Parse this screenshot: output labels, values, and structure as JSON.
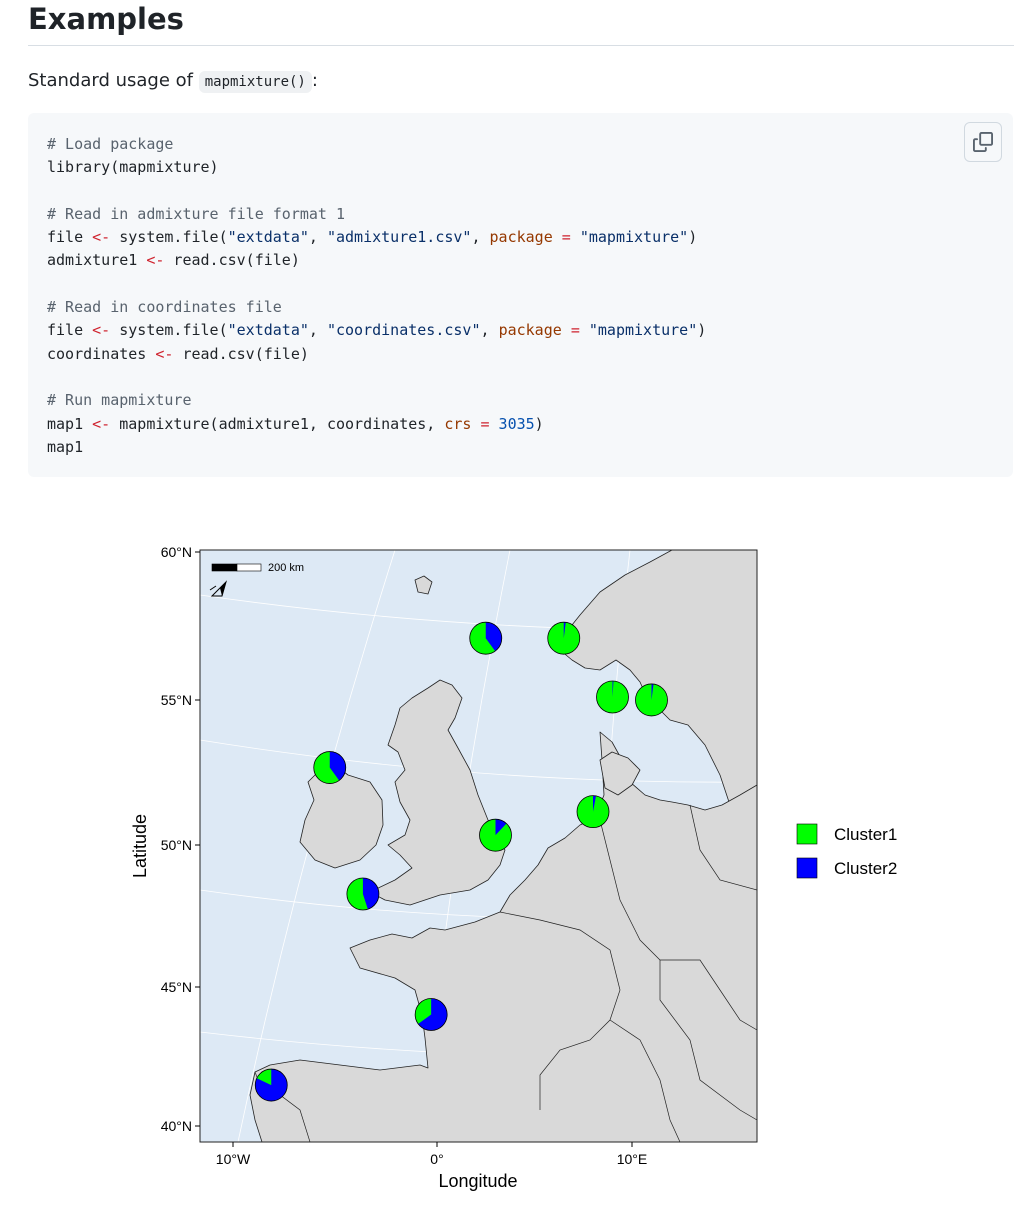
{
  "section": {
    "heading": "Examples",
    "intro_prefix": "Standard usage of ",
    "intro_code": "mapmixture()",
    "intro_suffix": ":"
  },
  "code_block": {
    "lines": [
      [
        {
          "t": "# Load package",
          "c": "comment"
        }
      ],
      [
        {
          "t": "library(mapmixture)",
          "c": "plain"
        }
      ],
      [],
      [
        {
          "t": "# Read in admixture file format 1",
          "c": "comment"
        }
      ],
      [
        {
          "t": "file ",
          "c": "plain"
        },
        {
          "t": "<-",
          "c": "op"
        },
        {
          "t": " system.file(",
          "c": "plain"
        },
        {
          "t": "\"extdata\"",
          "c": "string"
        },
        {
          "t": ", ",
          "c": "plain"
        },
        {
          "t": "\"admixture1.csv\"",
          "c": "string"
        },
        {
          "t": ", ",
          "c": "plain"
        },
        {
          "t": "package",
          "c": "arg"
        },
        {
          "t": " ",
          "c": "plain"
        },
        {
          "t": "=",
          "c": "op"
        },
        {
          "t": " ",
          "c": "plain"
        },
        {
          "t": "\"mapmixture\"",
          "c": "string"
        },
        {
          "t": ")",
          "c": "plain"
        }
      ],
      [
        {
          "t": "admixture1 ",
          "c": "plain"
        },
        {
          "t": "<-",
          "c": "op"
        },
        {
          "t": " read.csv(file)",
          "c": "plain"
        }
      ],
      [],
      [
        {
          "t": "# Read in coordinates file",
          "c": "comment"
        }
      ],
      [
        {
          "t": "file ",
          "c": "plain"
        },
        {
          "t": "<-",
          "c": "op"
        },
        {
          "t": " system.file(",
          "c": "plain"
        },
        {
          "t": "\"extdata\"",
          "c": "string"
        },
        {
          "t": ", ",
          "c": "plain"
        },
        {
          "t": "\"coordinates.csv\"",
          "c": "string"
        },
        {
          "t": ", ",
          "c": "plain"
        },
        {
          "t": "package",
          "c": "arg"
        },
        {
          "t": " ",
          "c": "plain"
        },
        {
          "t": "=",
          "c": "op"
        },
        {
          "t": " ",
          "c": "plain"
        },
        {
          "t": "\"mapmixture\"",
          "c": "string"
        },
        {
          "t": ")",
          "c": "plain"
        }
      ],
      [
        {
          "t": "coordinates ",
          "c": "plain"
        },
        {
          "t": "<-",
          "c": "op"
        },
        {
          "t": " read.csv(file)",
          "c": "plain"
        }
      ],
      [],
      [
        {
          "t": "# Run mapmixture",
          "c": "comment"
        }
      ],
      [
        {
          "t": "map1 ",
          "c": "plain"
        },
        {
          "t": "<-",
          "c": "op"
        },
        {
          "t": " mapmixture(admixture1, coordinates, ",
          "c": "plain"
        },
        {
          "t": "crs",
          "c": "arg"
        },
        {
          "t": " ",
          "c": "plain"
        },
        {
          "t": "=",
          "c": "op"
        },
        {
          "t": " ",
          "c": "plain"
        },
        {
          "t": "3035",
          "c": "num"
        },
        {
          "t": ")",
          "c": "plain"
        }
      ],
      [
        {
          "t": "map1",
          "c": "plain"
        }
      ]
    ],
    "copy_icon": "copy-icon"
  },
  "chart_data": {
    "type": "map-pie",
    "xlabel": "Longitude",
    "ylabel": "Latitude",
    "x_ticks": [
      "10°W",
      "0°",
      "10°E"
    ],
    "y_ticks": [
      "60°N",
      "55°N",
      "50°N",
      "45°N",
      "40°N"
    ],
    "scale_bar_label": "200 km",
    "north_arrow_icon": "north-arrow-icon",
    "legend": [
      {
        "name": "Cluster1",
        "color": "#00ff00"
      },
      {
        "name": "Cluster2",
        "color": "#0000ff"
      }
    ],
    "colors": {
      "sea": "#dde9f5",
      "land": "#d9d9d9",
      "border": "#222222"
    },
    "sites": [
      {
        "lon": 2.5,
        "lat": 57.0,
        "cluster2": 0.4
      },
      {
        "lon": 6.5,
        "lat": 57.0,
        "cluster2": 0.02
      },
      {
        "lon": 9.0,
        "lat": 55.0,
        "cluster2": 0.01
      },
      {
        "lon": 11.0,
        "lat": 54.9,
        "cluster2": 0.02
      },
      {
        "lon": -5.5,
        "lat": 52.6,
        "cluster2": 0.4
      },
      {
        "lon": 8.0,
        "lat": 51.1,
        "cluster2": 0.03
      },
      {
        "lon": 3.0,
        "lat": 50.3,
        "cluster2": 0.12
      },
      {
        "lon": -3.8,
        "lat": 48.3,
        "cluster2": 0.45
      },
      {
        "lon": -0.3,
        "lat": 44.2,
        "cluster2": 0.65
      },
      {
        "lon": -8.5,
        "lat": 41.8,
        "cluster2": 0.82
      }
    ]
  }
}
